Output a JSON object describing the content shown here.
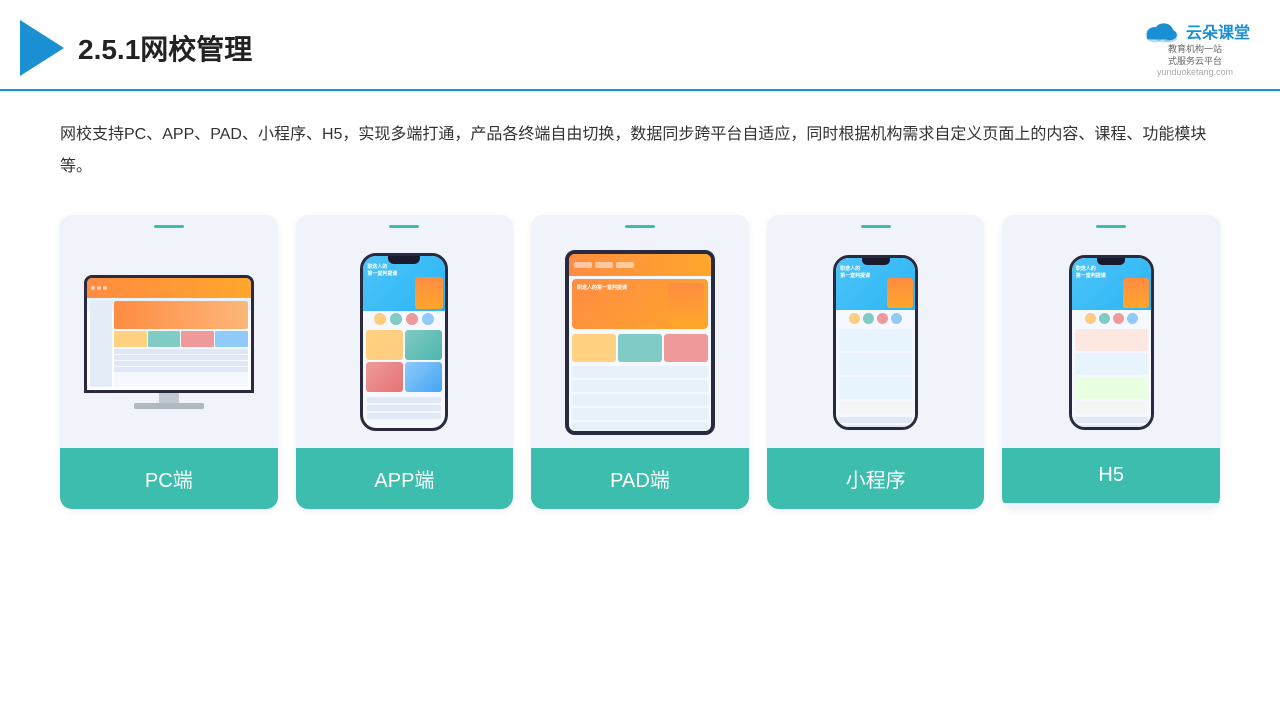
{
  "header": {
    "title": "2.5.1网校管理",
    "brand": {
      "name_cn": "云朵课堂",
      "tagline": "教育机构一站\n式服务云平台",
      "url": "yunduoketang.com"
    }
  },
  "description": {
    "text": "网校支持PC、APP、PAD、小程序、H5，实现多端打通，产品各终端自由切换，数据同步跨平台自适应，同时根据机构需求自定义页面上的内容、课程、功能模块等。"
  },
  "cards": [
    {
      "label": "PC端",
      "id": "pc"
    },
    {
      "label": "APP端",
      "id": "app"
    },
    {
      "label": "PAD端",
      "id": "pad"
    },
    {
      "label": "小程序",
      "id": "mini"
    },
    {
      "label": "H5",
      "id": "h5"
    }
  ],
  "colors": {
    "accent": "#3dbdad",
    "header_line": "#1296db",
    "logo": "#1a8fd1"
  }
}
